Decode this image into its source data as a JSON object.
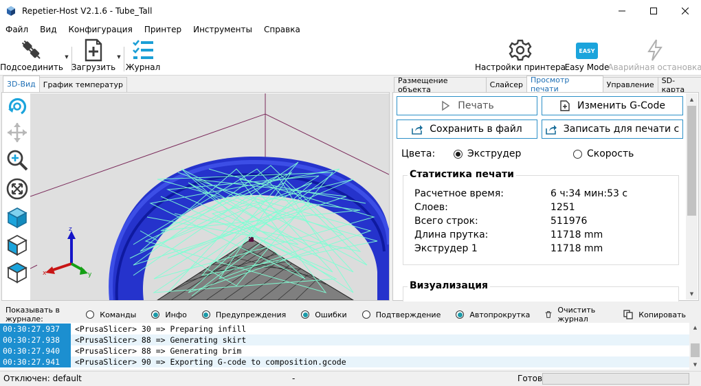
{
  "window": {
    "title": "Repetier-Host V2.1.6 - Tube_Tall"
  },
  "menu": [
    "Файл",
    "Вид",
    "Конфигурация",
    "Принтер",
    "Инструменты",
    "Справка"
  ],
  "toolbar": {
    "connect": "Подсоединить",
    "load": "Загрузить",
    "log": "Журнал",
    "printer_settings": "Настройки принтера",
    "easy_mode": "Easy Mode",
    "easy_badge": "EASY",
    "emergency_stop": "Аварийная остановка"
  },
  "left_tabs": [
    "3D-Вид",
    "График температур"
  ],
  "right_tabs": [
    "Размещение объекта",
    "Слайсер",
    "Просмотр печати",
    "Управление",
    "SD-карта"
  ],
  "print_preview": {
    "print_button": "Печать",
    "edit_gcode_button": "Изменить G-Code",
    "save_file_button": "Сохранить в файл",
    "write_sd_button": "Записать для печати с",
    "colors_label": "Цвета:",
    "color_extruder": "Экструдер",
    "color_speed": "Скорость",
    "stats_title": "Статистика печати",
    "stats": [
      {
        "label": "Расчетное время:",
        "value": "6 ч:34 мин:53 с"
      },
      {
        "label": "Слоев:",
        "value": "1251"
      },
      {
        "label": "Всего строк:",
        "value": "511976"
      },
      {
        "label": "Длина прутка:",
        "value": "11718 mm"
      },
      {
        "label": "Экструдер 1",
        "value": "11718 mm"
      }
    ],
    "viz_title": "Визуализация"
  },
  "log_bar": {
    "show_label": "Показывать в журнале:",
    "commands": "Команды",
    "info": "Инфо",
    "warnings": "Предупреждения",
    "errors": "Ошибки",
    "confirm": "Подтверждение",
    "autoscroll": "Автопрокрутка",
    "clear": "Очистить журнал",
    "copy": "Копировать"
  },
  "log": [
    {
      "time": "00:30:27.937",
      "message": "<PrusaSlicer> 30 => Preparing infill"
    },
    {
      "time": "00:30:27.938",
      "message": "<PrusaSlicer> 88 => Generating skirt"
    },
    {
      "time": "00:30:27.940",
      "message": "<PrusaSlicer> 88 => Generating brim"
    },
    {
      "time": "00:30:27.941",
      "message": "<PrusaSlicer> 90 => Exporting G-code to composition.gcode"
    }
  ],
  "status": {
    "connection": "Отключен: default",
    "middle": "-",
    "state": "Готов"
  },
  "colors": {
    "accent": "#2b8fc7",
    "log_time_bg": "#1c8fd0",
    "model_blue": "#1f2fd0",
    "travel": "#7fffd4"
  }
}
